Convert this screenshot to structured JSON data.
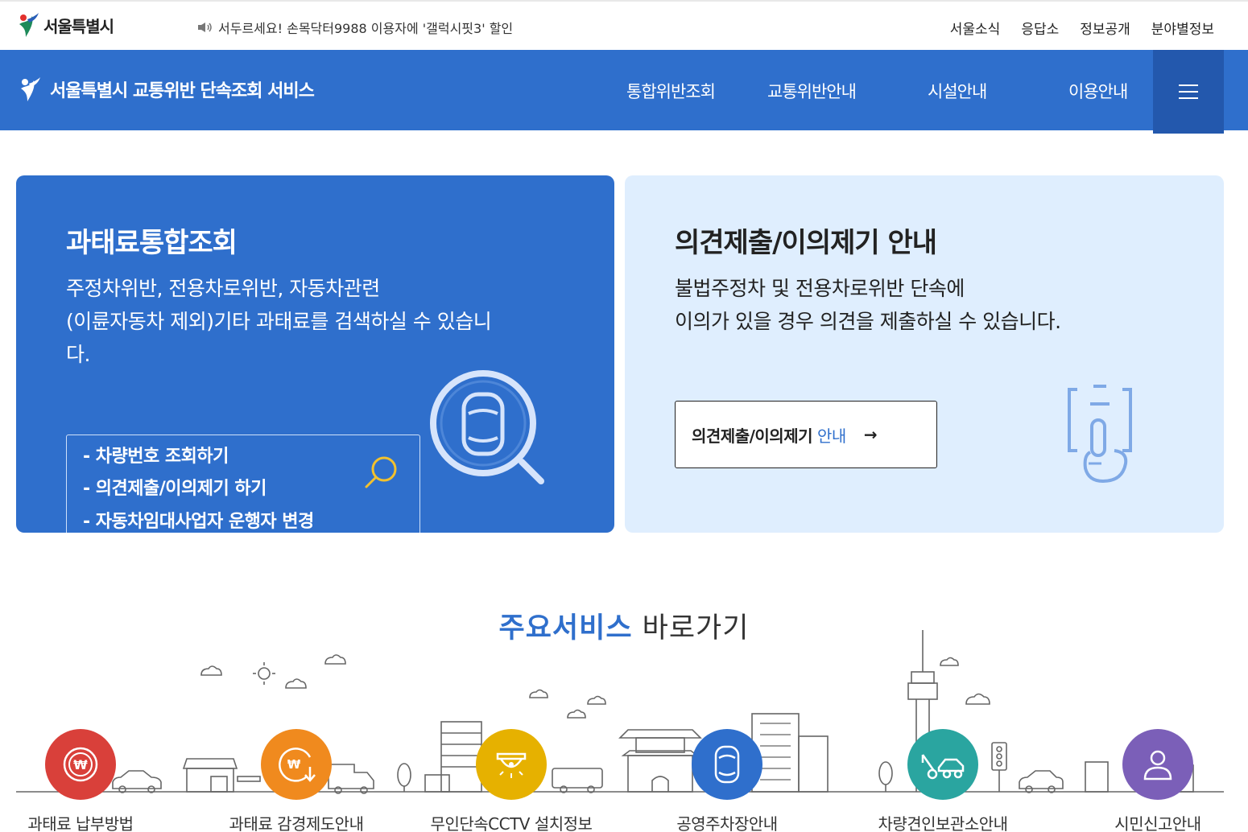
{
  "topbar": {
    "logo_text": "서울특별시",
    "notice": "서두르세요! 손목닥터9988 이용자에 '갤럭시핏3' 할인",
    "links": [
      "서울소식",
      "응답소",
      "정보공개",
      "분야별정보"
    ]
  },
  "nav": {
    "site_title": "서울특별시 교통위반 단속조회 서비스",
    "menu": [
      "통합위반조회",
      "교통위반안내",
      "시설안내",
      "이용안내"
    ]
  },
  "card_left": {
    "title": "과태료통합조회",
    "desc_lines": [
      "주정차위반, 전용차로위반, 자동차관련",
      "(이륜자동차 제외)기타 과태료를 검색하실 수 있습니",
      "다."
    ],
    "quick_links": [
      "- 차량번호 조회하기",
      "- 의견제출/이의제기 하기",
      "- 자동차임대사업자 운행자 변경"
    ]
  },
  "card_right": {
    "title": "의견제출/이의제기 안내",
    "desc_lines": [
      "불법주정차 및 전용차로위반 단속에",
      "이의가 있을 경우 의견을 제출하실 수 있습니다."
    ],
    "button_main": "의견제출/이의제기",
    "button_accent": "안내",
    "button_arrow": "→"
  },
  "section": {
    "title_highlight": "주요서비스",
    "title_rest": " 바로가기"
  },
  "services": [
    {
      "label": "과태료 납부방법",
      "color": "#d9403a",
      "icon": "won-coin-icon"
    },
    {
      "label": "과태료 감경제도안내",
      "color": "#f08a1e",
      "icon": "won-discount-icon"
    },
    {
      "label": "무인단속CCTV 설치정보",
      "color": "#e6b100",
      "icon": "cctv-icon"
    },
    {
      "label": "공영주차장안내",
      "color": "#2f6fcc",
      "icon": "car-top-icon"
    },
    {
      "label": "차량견인보관소안내",
      "color": "#2aa5a0",
      "icon": "tow-truck-icon"
    },
    {
      "label": "시민신고안내",
      "color": "#7b5fb8",
      "icon": "person-icon"
    }
  ],
  "colors": {
    "primary": "#2f6fcc",
    "primary_dark": "#2358ad",
    "light_card": "#dfeefe",
    "accent_yellow": "#f2c12e"
  }
}
